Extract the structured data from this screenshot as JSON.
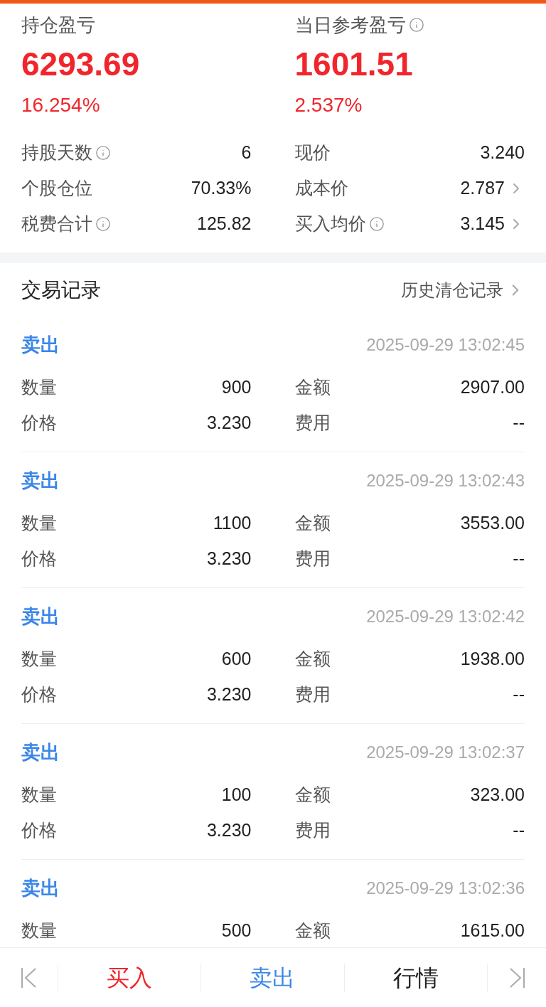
{
  "summary": [
    {
      "label": "持仓盈亏",
      "info": false,
      "value": "6293.69",
      "percent": "16.254%"
    },
    {
      "label": "当日参考盈亏",
      "info": true,
      "value": "1601.51",
      "percent": "2.537%"
    }
  ],
  "stats": [
    {
      "label": "持股天数",
      "info": true,
      "value": "6",
      "link": false
    },
    {
      "label": "现价",
      "info": false,
      "value": "3.240",
      "link": false
    },
    {
      "label": "个股仓位",
      "info": false,
      "value": "70.33%",
      "link": false
    },
    {
      "label": "成本价",
      "info": false,
      "value": "2.787",
      "link": true
    },
    {
      "label": "税费合计",
      "info": true,
      "value": "125.82",
      "link": false
    },
    {
      "label": "买入均价",
      "info": true,
      "value": "3.145",
      "link": true
    }
  ],
  "trades_header": {
    "title": "交易记录",
    "history_link": "历史清仓记录"
  },
  "trades": [
    {
      "kind": "sell",
      "side": "卖出",
      "time": "2025-09-29 13:02:45",
      "fields": [
        {
          "label": "数量",
          "value": "900"
        },
        {
          "label": "金额",
          "value": "2907.00"
        },
        {
          "label": "价格",
          "value": "3.230"
        },
        {
          "label": "费用",
          "value": "--"
        }
      ]
    },
    {
      "kind": "sell",
      "side": "卖出",
      "time": "2025-09-29 13:02:43",
      "fields": [
        {
          "label": "数量",
          "value": "1100"
        },
        {
          "label": "金额",
          "value": "3553.00"
        },
        {
          "label": "价格",
          "value": "3.230"
        },
        {
          "label": "费用",
          "value": "--"
        }
      ]
    },
    {
      "kind": "sell",
      "side": "卖出",
      "time": "2025-09-29 13:02:42",
      "fields": [
        {
          "label": "数量",
          "value": "600"
        },
        {
          "label": "金额",
          "value": "1938.00"
        },
        {
          "label": "价格",
          "value": "3.230"
        },
        {
          "label": "费用",
          "value": "--"
        }
      ]
    },
    {
      "kind": "sell",
      "side": "卖出",
      "time": "2025-09-29 13:02:37",
      "fields": [
        {
          "label": "数量",
          "value": "100"
        },
        {
          "label": "金额",
          "value": "323.00"
        },
        {
          "label": "价格",
          "value": "3.230"
        },
        {
          "label": "费用",
          "value": "--"
        }
      ]
    },
    {
      "kind": "sell",
      "side": "卖出",
      "time": "2025-09-29 13:02:36",
      "fields": [
        {
          "label": "数量",
          "value": "500"
        },
        {
          "label": "金额",
          "value": "1615.00"
        }
      ]
    }
  ],
  "toolbar": [
    {
      "kind": "first"
    },
    {
      "kind": "buy",
      "label": "买入"
    },
    {
      "kind": "sell",
      "label": "卖出"
    },
    {
      "kind": "plain",
      "label": "行情"
    },
    {
      "kind": "last"
    }
  ]
}
